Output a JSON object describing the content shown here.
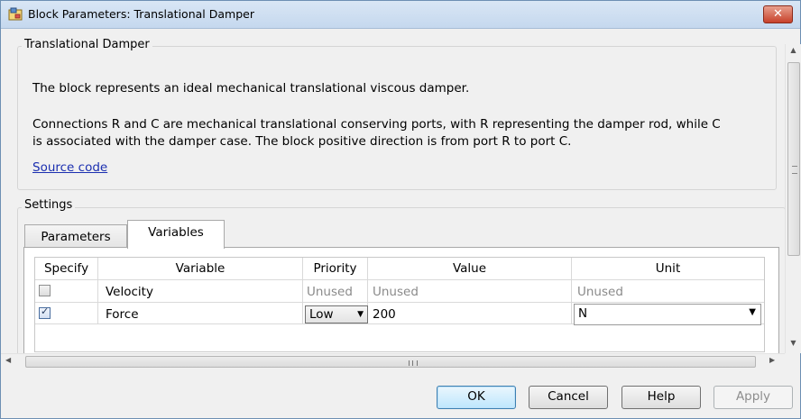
{
  "window": {
    "title": "Block Parameters: Translational Damper"
  },
  "description": {
    "group_title": "Translational Damper",
    "line1": "The block represents an ideal mechanical translational viscous damper.",
    "line2": "Connections R and C are mechanical translational conserving ports, with R representing the damper rod, while C",
    "line3": "is associated with the damper case. The block positive direction is from port R to port C.",
    "link": "Source code"
  },
  "settings": {
    "group_title": "Settings",
    "tabs": [
      {
        "label": "Parameters",
        "active": false
      },
      {
        "label": "Variables",
        "active": true
      }
    ],
    "table": {
      "headers": [
        "Specify",
        "Variable",
        "Priority",
        "Value",
        "Unit"
      ],
      "rows": [
        {
          "specify": false,
          "variable": "Velocity",
          "priority": "Unused",
          "value": "Unused",
          "unit": "Unused"
        },
        {
          "specify": true,
          "variable": "Force",
          "priority": "Low",
          "value": "200",
          "unit": "N"
        }
      ]
    }
  },
  "buttons": {
    "ok": "OK",
    "cancel": "Cancel",
    "help": "Help",
    "apply": "Apply"
  },
  "scroll": {
    "h_grip": "III"
  },
  "colors": {
    "link": "#1b2fb0",
    "close_button": "#c7412a",
    "default_button": "#bee6fd"
  }
}
